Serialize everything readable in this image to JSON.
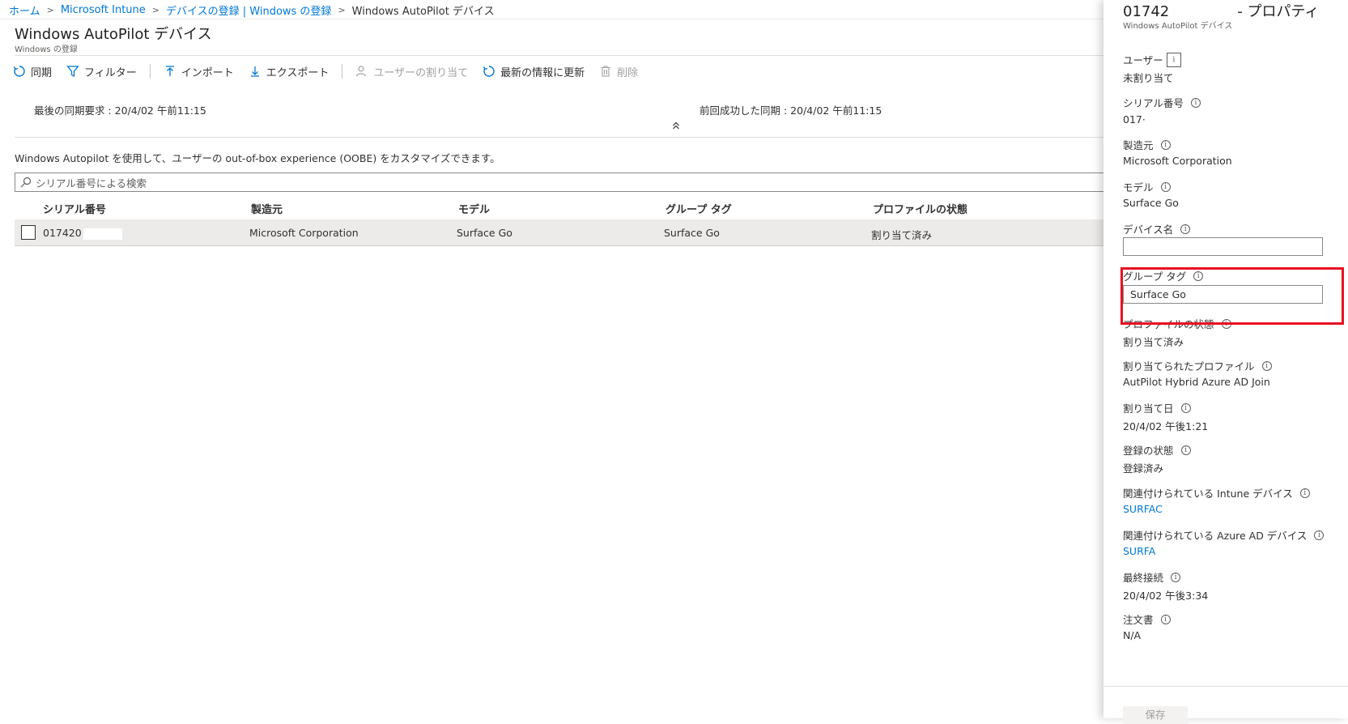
{
  "breadcrumb": {
    "home": "ホーム",
    "intune": "Microsoft Intune",
    "enrollment": "デバイスの登録 | Windows の登録",
    "current": "Windows AutoPilot デバイス"
  },
  "page": {
    "title": "Windows AutoPilot デバイス",
    "subtitle": "Windows の登録"
  },
  "toolbar": {
    "sync": "同期",
    "filter": "フィルター",
    "import": "インポート",
    "export": "エクスポート",
    "assign_user": "ユーザーの割り当て",
    "refresh": "最新の情報に更新",
    "delete": "削除"
  },
  "sync_info": {
    "last_request": "最後の同期要求 : 20/4/02 午前11:15",
    "last_success": "前回成功した同期 : 20/4/02 午前11:15"
  },
  "description": "Windows Autopilot を使用して、ユーザーの out-of-box experience (OOBE) をカスタマイズできます。",
  "search": {
    "placeholder": "シリアル番号による検索"
  },
  "table": {
    "columns": [
      "シリアル番号",
      "製造元",
      "モデル",
      "グループ タグ",
      "プロファイルの状態"
    ],
    "rows": [
      {
        "serial": "017420",
        "manufacturer": "Microsoft Corporation",
        "model": "Surface Go",
        "group_tag": "Surface Go",
        "profile_status": "割り当て済み"
      }
    ]
  },
  "panel": {
    "title_prefix": "01742",
    "title_suffix": "- プロパティ",
    "subtitle": "Windows AutoPilot デバイス",
    "user_label": "ユーザー",
    "user_value": "未割り当て",
    "serial_label": "シリアル番号",
    "serial_value": "017·",
    "manufacturer_label": "製造元",
    "manufacturer_value": "Microsoft Corporation",
    "model_label": "モデル",
    "model_value": "Surface Go",
    "device_name_label": "デバイス名",
    "device_name_value": "",
    "group_tag_label": "グループ タグ",
    "group_tag_value": "Surface Go",
    "profile_status_label": "プロファイルの状態",
    "profile_status_value": "割り当て済み",
    "assigned_profile_label": "割り当てられたプロファイル",
    "assigned_profile_value": "AutPilot Hybrid Azure AD Join",
    "assigned_date_label": "割り当て日",
    "assigned_date_value": "20/4/02 午後1:21",
    "enrollment_status_label": "登録の状態",
    "enrollment_status_value": "登録済み",
    "intune_device_label": "関連付けられている Intune デバイス",
    "intune_device_value": "SURFAC",
    "azure_device_label": "関連付けられている Azure AD デバイス",
    "azure_device_value": "SURFA",
    "last_contact_label": "最終接続",
    "last_contact_value": "20/4/02 午後3:34",
    "order_label": "注文書",
    "order_value": "N/A",
    "save": "保存"
  },
  "colors": {
    "accent": "#0078d4",
    "highlight": "#e81123"
  }
}
